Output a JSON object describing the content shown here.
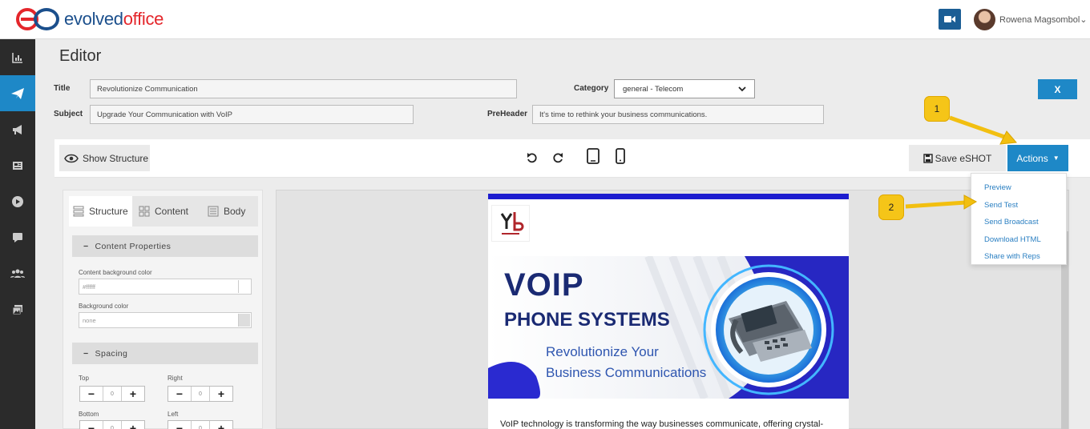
{
  "brand": {
    "name_part1": "evolved",
    "name_part2": "office"
  },
  "header": {
    "user_name": "Rowena Magsombol"
  },
  "page": {
    "title": "Editor"
  },
  "form": {
    "title_label": "Title",
    "title_value": "Revolutionize Communication",
    "subject_label": "Subject",
    "subject_value": "Upgrade Your Communication with VoIP",
    "category_label": "Category",
    "category_value": "general - Telecom",
    "preheader_label": "PreHeader",
    "preheader_value": "It's time to rethink your business communications.",
    "close_label": "X"
  },
  "toolbar": {
    "show_structure_label": "Show Structure",
    "save_label": "Save eSHOT",
    "actions_label": "Actions"
  },
  "actions_menu": {
    "items": [
      "Preview",
      "Send Test",
      "Send Broadcast",
      "Download HTML",
      "Share with Reps"
    ]
  },
  "left_panel": {
    "tabs": [
      "Structure",
      "Content",
      "Body"
    ],
    "content_properties_label": "Content Properties",
    "content_bg_label": "Content background color",
    "content_bg_value": "#ffffff",
    "bg_label": "Background color",
    "bg_value": "none",
    "spacing_label": "Spacing",
    "top_label": "Top",
    "right_label": "Right",
    "bottom_label": "Bottom",
    "left_label": "Left",
    "top_value": "0",
    "right_value": "0",
    "bottom_value": "0",
    "left_value": "0"
  },
  "email": {
    "banner_title": "VOIP",
    "banner_subtitle": "PHONE SYSTEMS",
    "banner_tagline_1": "Revolutionize Your",
    "banner_tagline_2": "Business Communications",
    "body_text": "VoIP technology is transforming the way businesses communicate, offering crystal-"
  },
  "callouts": [
    "1",
    "2"
  ],
  "colors": {
    "accent": "#1e88c7",
    "sidebar": "#2b2b2b",
    "callout": "#f5c518",
    "email_blue": "#1c1ccf"
  }
}
